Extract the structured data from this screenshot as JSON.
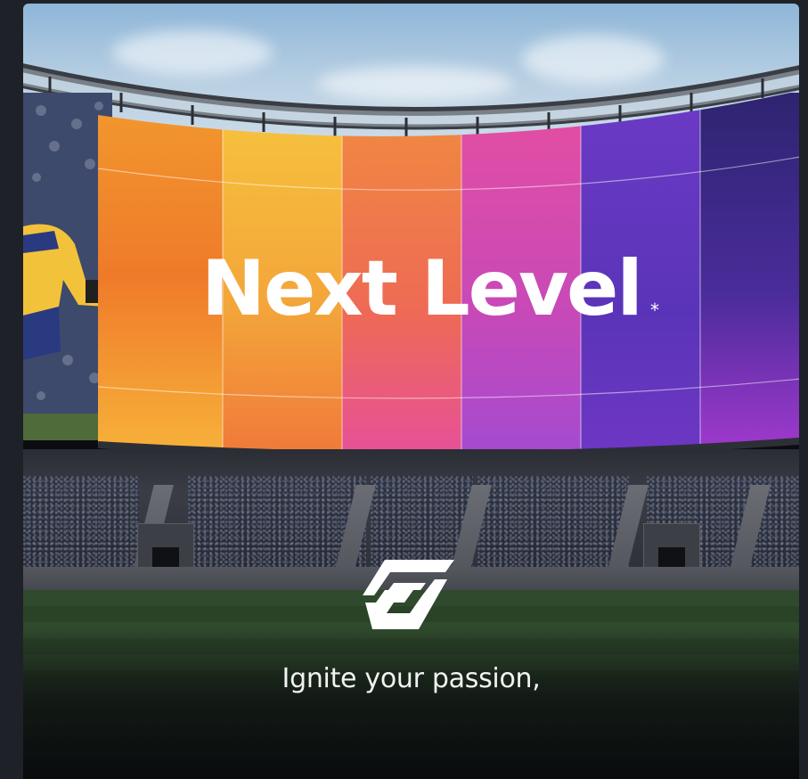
{
  "banner": {
    "headline": "Next Level",
    "headline_mark": "*",
    "tagline": "Ignite your passion,",
    "logo_icon": "brand-logo-icon",
    "screen_colors": [
      "#f28a2a",
      "#f5b63a",
      "#f07a45",
      "#e0509a",
      "#6a3cc0",
      "#3b2a8e"
    ]
  }
}
